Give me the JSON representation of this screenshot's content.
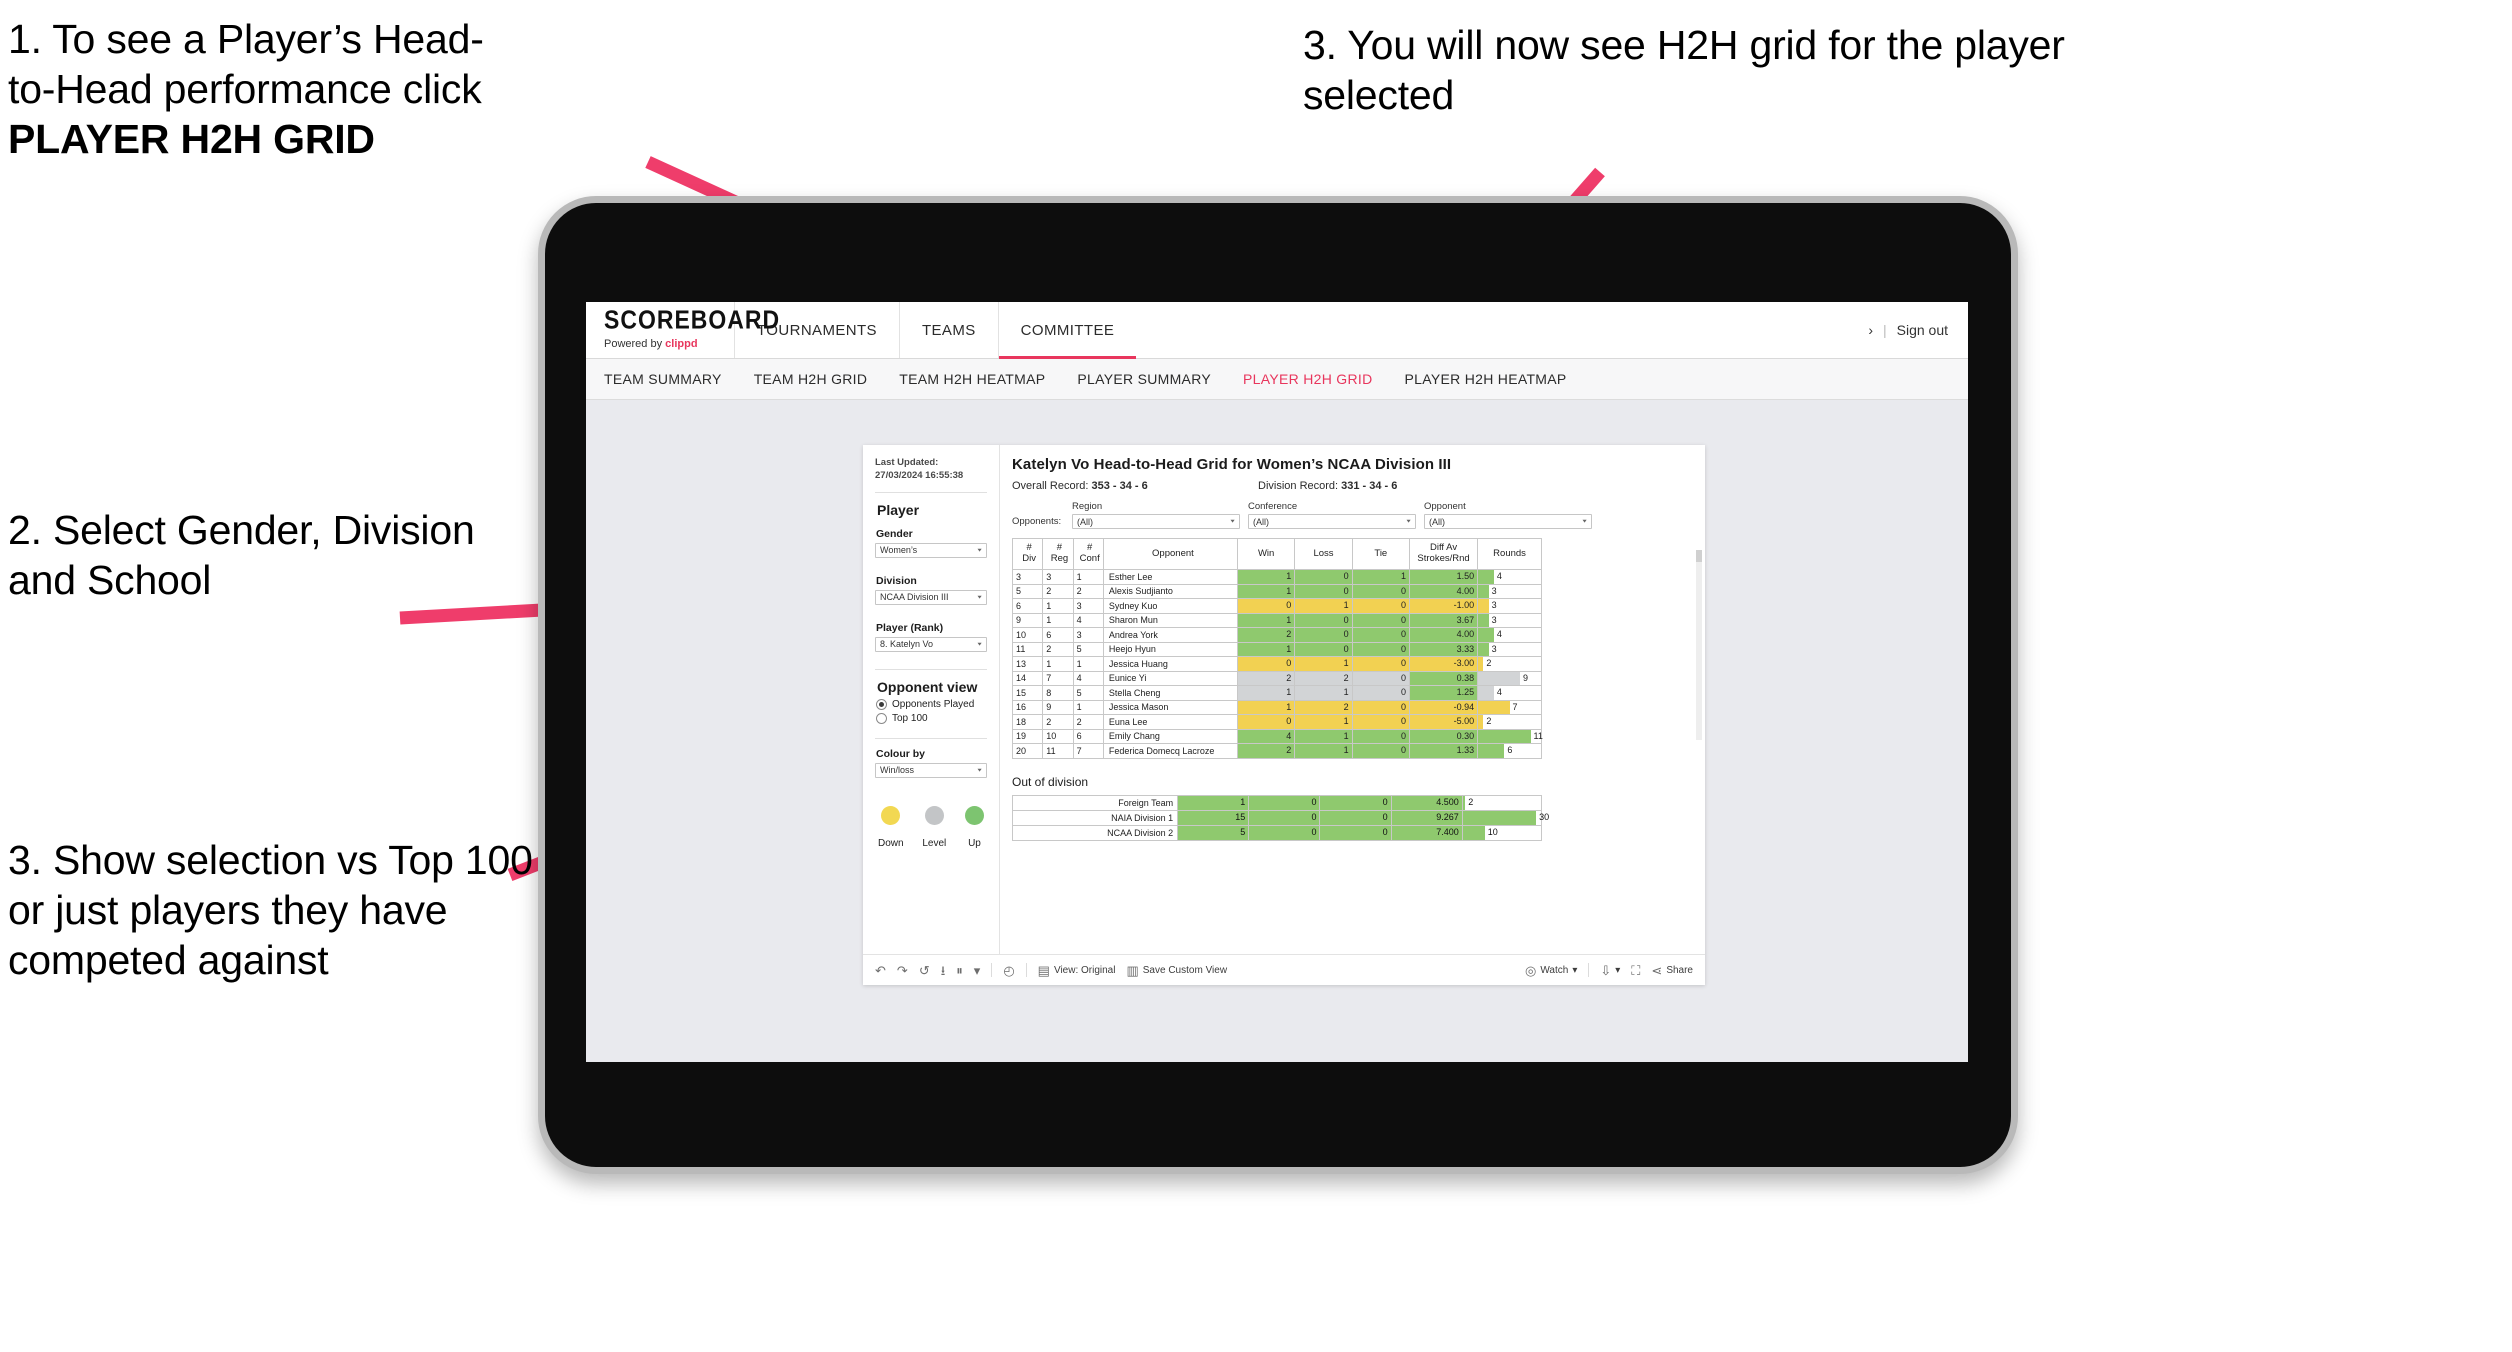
{
  "annotations": {
    "step1_line1": "1. To see a Player’s Head-",
    "step1_line2": "to-Head performance click",
    "step1_bold": "PLAYER H2H GRID",
    "step2": "2. Select Gender, Division and School",
    "step3_left": "3. Show selection vs Top 100 or just players they have competed against",
    "step3_top": "3. You will now see H2H grid for the player selected"
  },
  "app": {
    "brand": {
      "title": "SCOREBOARD",
      "powered_prefix": "Powered by ",
      "powered_brand": "clippd"
    },
    "nav": [
      {
        "label": "TOURNAMENTS",
        "active": false
      },
      {
        "label": "TEAMS",
        "active": false
      },
      {
        "label": "COMMITTEE",
        "active": true
      }
    ],
    "account": {
      "chevron": "›",
      "separator": "|",
      "sign_out": "Sign out"
    },
    "tabs": [
      {
        "label": "TEAM SUMMARY",
        "selected": false
      },
      {
        "label": "TEAM H2H GRID",
        "selected": false
      },
      {
        "label": "TEAM H2H HEATMAP",
        "selected": false
      },
      {
        "label": "PLAYER SUMMARY",
        "selected": false
      },
      {
        "label": "PLAYER H2H GRID",
        "selected": true
      },
      {
        "label": "PLAYER H2H HEATMAP",
        "selected": false
      }
    ]
  },
  "sidebar": {
    "last_updated": "Last Updated: 27/03/2024 16:55:38",
    "section_player": "Player",
    "gender": {
      "label": "Gender",
      "value": "Women’s"
    },
    "division": {
      "label": "Division",
      "value": "NCAA Division III"
    },
    "player_rank": {
      "label": "Player (Rank)",
      "value": "8. Katelyn Vo"
    },
    "opponent_view": {
      "label": "Opponent view",
      "options": [
        {
          "label": "Opponents Played",
          "selected": true
        },
        {
          "label": "Top 100",
          "selected": false
        }
      ]
    },
    "colour_by": {
      "label": "Colour by",
      "value": "Win/loss"
    },
    "legend": [
      {
        "label": "Down",
        "color": "#f2d852"
      },
      {
        "label": "Level",
        "color": "#c3c5c7"
      },
      {
        "label": "Up",
        "color": "#7dc470"
      }
    ]
  },
  "view": {
    "title": "Katelyn Vo Head-to-Head Grid for Women’s NCAA Division III",
    "overall_record_label": "Overall Record: ",
    "overall_record_value": "353 - 34 - 6",
    "division_record_label": "Division Record: ",
    "division_record_value": "331 - 34 - 6",
    "opponents_label": "Opponents:",
    "filters": [
      {
        "label": "Region",
        "value": "(All)"
      },
      {
        "label": "Conference",
        "value": "(All)"
      },
      {
        "label": "Opponent",
        "value": "(All)"
      }
    ]
  },
  "chart_data": {
    "type": "table",
    "title": "Katelyn Vo Head-to-Head Grid for Women’s NCAA Division III",
    "columns": [
      "# Div",
      "# Reg",
      "# Conf",
      "Opponent",
      "Win",
      "Loss",
      "Tie",
      "Diff Av Strokes/Rnd",
      "Rounds"
    ],
    "column_headers_multiline": [
      [
        "#",
        "Div"
      ],
      [
        "#",
        "Reg"
      ],
      [
        "#",
        "Conf"
      ],
      [
        "Opponent"
      ],
      [
        "Win"
      ],
      [
        "Loss"
      ],
      [
        "Tie"
      ],
      [
        "Diff Av",
        "Strokes/Rnd"
      ],
      [
        "Rounds"
      ]
    ],
    "rounds_max": 12,
    "rows": [
      {
        "div": "3",
        "reg": "3",
        "conf": "1",
        "opponent": "Esther Lee",
        "win": "1",
        "loss": "0",
        "tie": "1",
        "diff": "1.50",
        "rounds": "4",
        "color": "#8fc96e",
        "rounds_bar": 3
      },
      {
        "div": "5",
        "reg": "2",
        "conf": "2",
        "opponent": "Alexis Sudjianto",
        "win": "1",
        "loss": "0",
        "tie": "0",
        "diff": "4.00",
        "rounds": "3",
        "color": "#8fc96e",
        "rounds_bar": 2
      },
      {
        "div": "6",
        "reg": "1",
        "conf": "3",
        "opponent": "Sydney Kuo",
        "win": "0",
        "loss": "1",
        "tie": "0",
        "diff": "-1.00",
        "rounds": "3",
        "color": "#f2d152",
        "rounds_bar": 2
      },
      {
        "div": "9",
        "reg": "1",
        "conf": "4",
        "opponent": "Sharon Mun",
        "win": "1",
        "loss": "0",
        "tie": "0",
        "diff": "3.67",
        "rounds": "3",
        "color": "#8fc96e",
        "rounds_bar": 2
      },
      {
        "div": "10",
        "reg": "6",
        "conf": "3",
        "opponent": "Andrea York",
        "win": "2",
        "loss": "0",
        "tie": "0",
        "diff": "4.00",
        "rounds": "4",
        "color": "#8fc96e",
        "rounds_bar": 3
      },
      {
        "div": "11",
        "reg": "2",
        "conf": "5",
        "opponent": "Heejo Hyun",
        "win": "1",
        "loss": "0",
        "tie": "0",
        "diff": "3.33",
        "rounds": "3",
        "color": "#8fc96e",
        "rounds_bar": 2
      },
      {
        "div": "13",
        "reg": "1",
        "conf": "1",
        "opponent": "Jessica Huang",
        "win": "0",
        "loss": "1",
        "tie": "0",
        "diff": "-3.00",
        "rounds": "2",
        "color": "#f2d152",
        "rounds_bar": 1
      },
      {
        "div": "14",
        "reg": "7",
        "conf": "4",
        "opponent": "Eunice Yi",
        "win": "2",
        "loss": "2",
        "tie": "0",
        "diff": "0.38",
        "rounds": "9",
        "color": "#d2d4d6",
        "diff_color": "#8fc96e",
        "rounds_bar": 8
      },
      {
        "div": "15",
        "reg": "8",
        "conf": "5",
        "opponent": "Stella Cheng",
        "win": "1",
        "loss": "1",
        "tie": "0",
        "diff": "1.25",
        "rounds": "4",
        "color": "#d2d4d6",
        "diff_color": "#8fc96e",
        "rounds_bar": 3
      },
      {
        "div": "16",
        "reg": "9",
        "conf": "1",
        "opponent": "Jessica Mason",
        "win": "1",
        "loss": "2",
        "tie": "0",
        "diff": "-0.94",
        "rounds": "7",
        "color": "#f2d152",
        "rounds_bar": 6
      },
      {
        "div": "18",
        "reg": "2",
        "conf": "2",
        "opponent": "Euna Lee",
        "win": "0",
        "loss": "1",
        "tie": "0",
        "diff": "-5.00",
        "rounds": "2",
        "color": "#f2d152",
        "rounds_bar": 1
      },
      {
        "div": "19",
        "reg": "10",
        "conf": "6",
        "opponent": "Emily Chang",
        "win": "4",
        "loss": "1",
        "tie": "0",
        "diff": "0.30",
        "rounds": "11",
        "color": "#8fc96e",
        "rounds_bar": 10
      },
      {
        "div": "20",
        "reg": "11",
        "conf": "7",
        "opponent": "Federica Domecq Lacroze",
        "win": "2",
        "loss": "1",
        "tie": "0",
        "diff": "1.33",
        "rounds": "6",
        "color": "#8fc96e",
        "rounds_bar": 5
      }
    ],
    "out_of_division": {
      "title": "Out of division",
      "rows": [
        {
          "label": "Foreign Team",
          "win": "1",
          "loss": "0",
          "tie": "0",
          "diff": "4.500",
          "rounds": "2",
          "color": "#8fc96e",
          "rounds_bar": 1
        },
        {
          "label": "NAIA Division 1",
          "win": "15",
          "loss": "0",
          "tie": "0",
          "diff": "9.267",
          "rounds": "30",
          "color": "#8fc96e",
          "rounds_bar": 30
        },
        {
          "label": "NCAA Division 2",
          "win": "5",
          "loss": "0",
          "tie": "0",
          "diff": "7.400",
          "rounds": "10",
          "color": "#8fc96e",
          "rounds_bar": 9
        }
      ],
      "rounds_max": 32
    }
  },
  "toolbar": {
    "undo": "↶",
    "redo": "↷",
    "revert": "↺",
    "refresh": "⭳",
    "pause": "⏸",
    "custom_caret": "▾",
    "clock": "◴",
    "view_label": "View: Original",
    "save_label": "Save Custom View",
    "watch_label": "Watch",
    "watch_caret": "▾",
    "download_caret": "▾",
    "share_label": "Share"
  }
}
